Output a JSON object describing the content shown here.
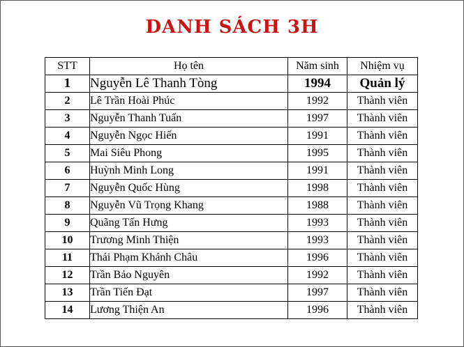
{
  "title": "DANH SÁCH 3H",
  "table": {
    "headers": [
      "STT",
      "Họ tên",
      "Năm sinh",
      "Nhiệm vụ"
    ],
    "rows": [
      {
        "stt": "1",
        "name": "Nguyễn Lê Thanh Tòng",
        "year": "1994",
        "role": "Quản lý"
      },
      {
        "stt": "2",
        "name": "Lê Trần Hoài Phúc",
        "year": "1992",
        "role": "Thành viên"
      },
      {
        "stt": "3",
        "name": "Nguyễn Thanh Tuấn",
        "year": "1997",
        "role": "Thành viên"
      },
      {
        "stt": "4",
        "name": "Nguyễn Ngọc Hiến",
        "year": "1991",
        "role": "Thành viên"
      },
      {
        "stt": "5",
        "name": "Mai Siêu Phong",
        "year": "1995",
        "role": "Thành viên"
      },
      {
        "stt": "6",
        "name": "Huỳnh Minh Long",
        "year": "1991",
        "role": "Thành viên"
      },
      {
        "stt": "7",
        "name": "Nguyễn Quốc Hùng",
        "year": "1998",
        "role": "Thành viên"
      },
      {
        "stt": "8",
        "name": "Nguyễn Vũ Trọng Khang",
        "year": "1988",
        "role": "Thành viên"
      },
      {
        "stt": "9",
        "name": "Quãng Tấn Hưng",
        "year": "1993",
        "role": "Thành viên"
      },
      {
        "stt": "10",
        "name": "Trương Minh Thiện",
        "year": "1993",
        "role": "Thành viên"
      },
      {
        "stt": "11",
        "name": "Thái Phạm Khánh Châu",
        "year": "1996",
        "role": "Thành viên"
      },
      {
        "stt": "12",
        "name": "Trần Bảo Nguyên",
        "year": "1992",
        "role": "Thành viên"
      },
      {
        "stt": "13",
        "name": "Trần Tiến Đạt",
        "year": "1997",
        "role": "Thành viên"
      },
      {
        "stt": "14",
        "name": "Lương Thiện An",
        "year": "1996",
        "role": "Thành viên"
      }
    ]
  },
  "colors": {
    "title": "#c81414",
    "border": "#000000",
    "background": "#ffffff"
  }
}
